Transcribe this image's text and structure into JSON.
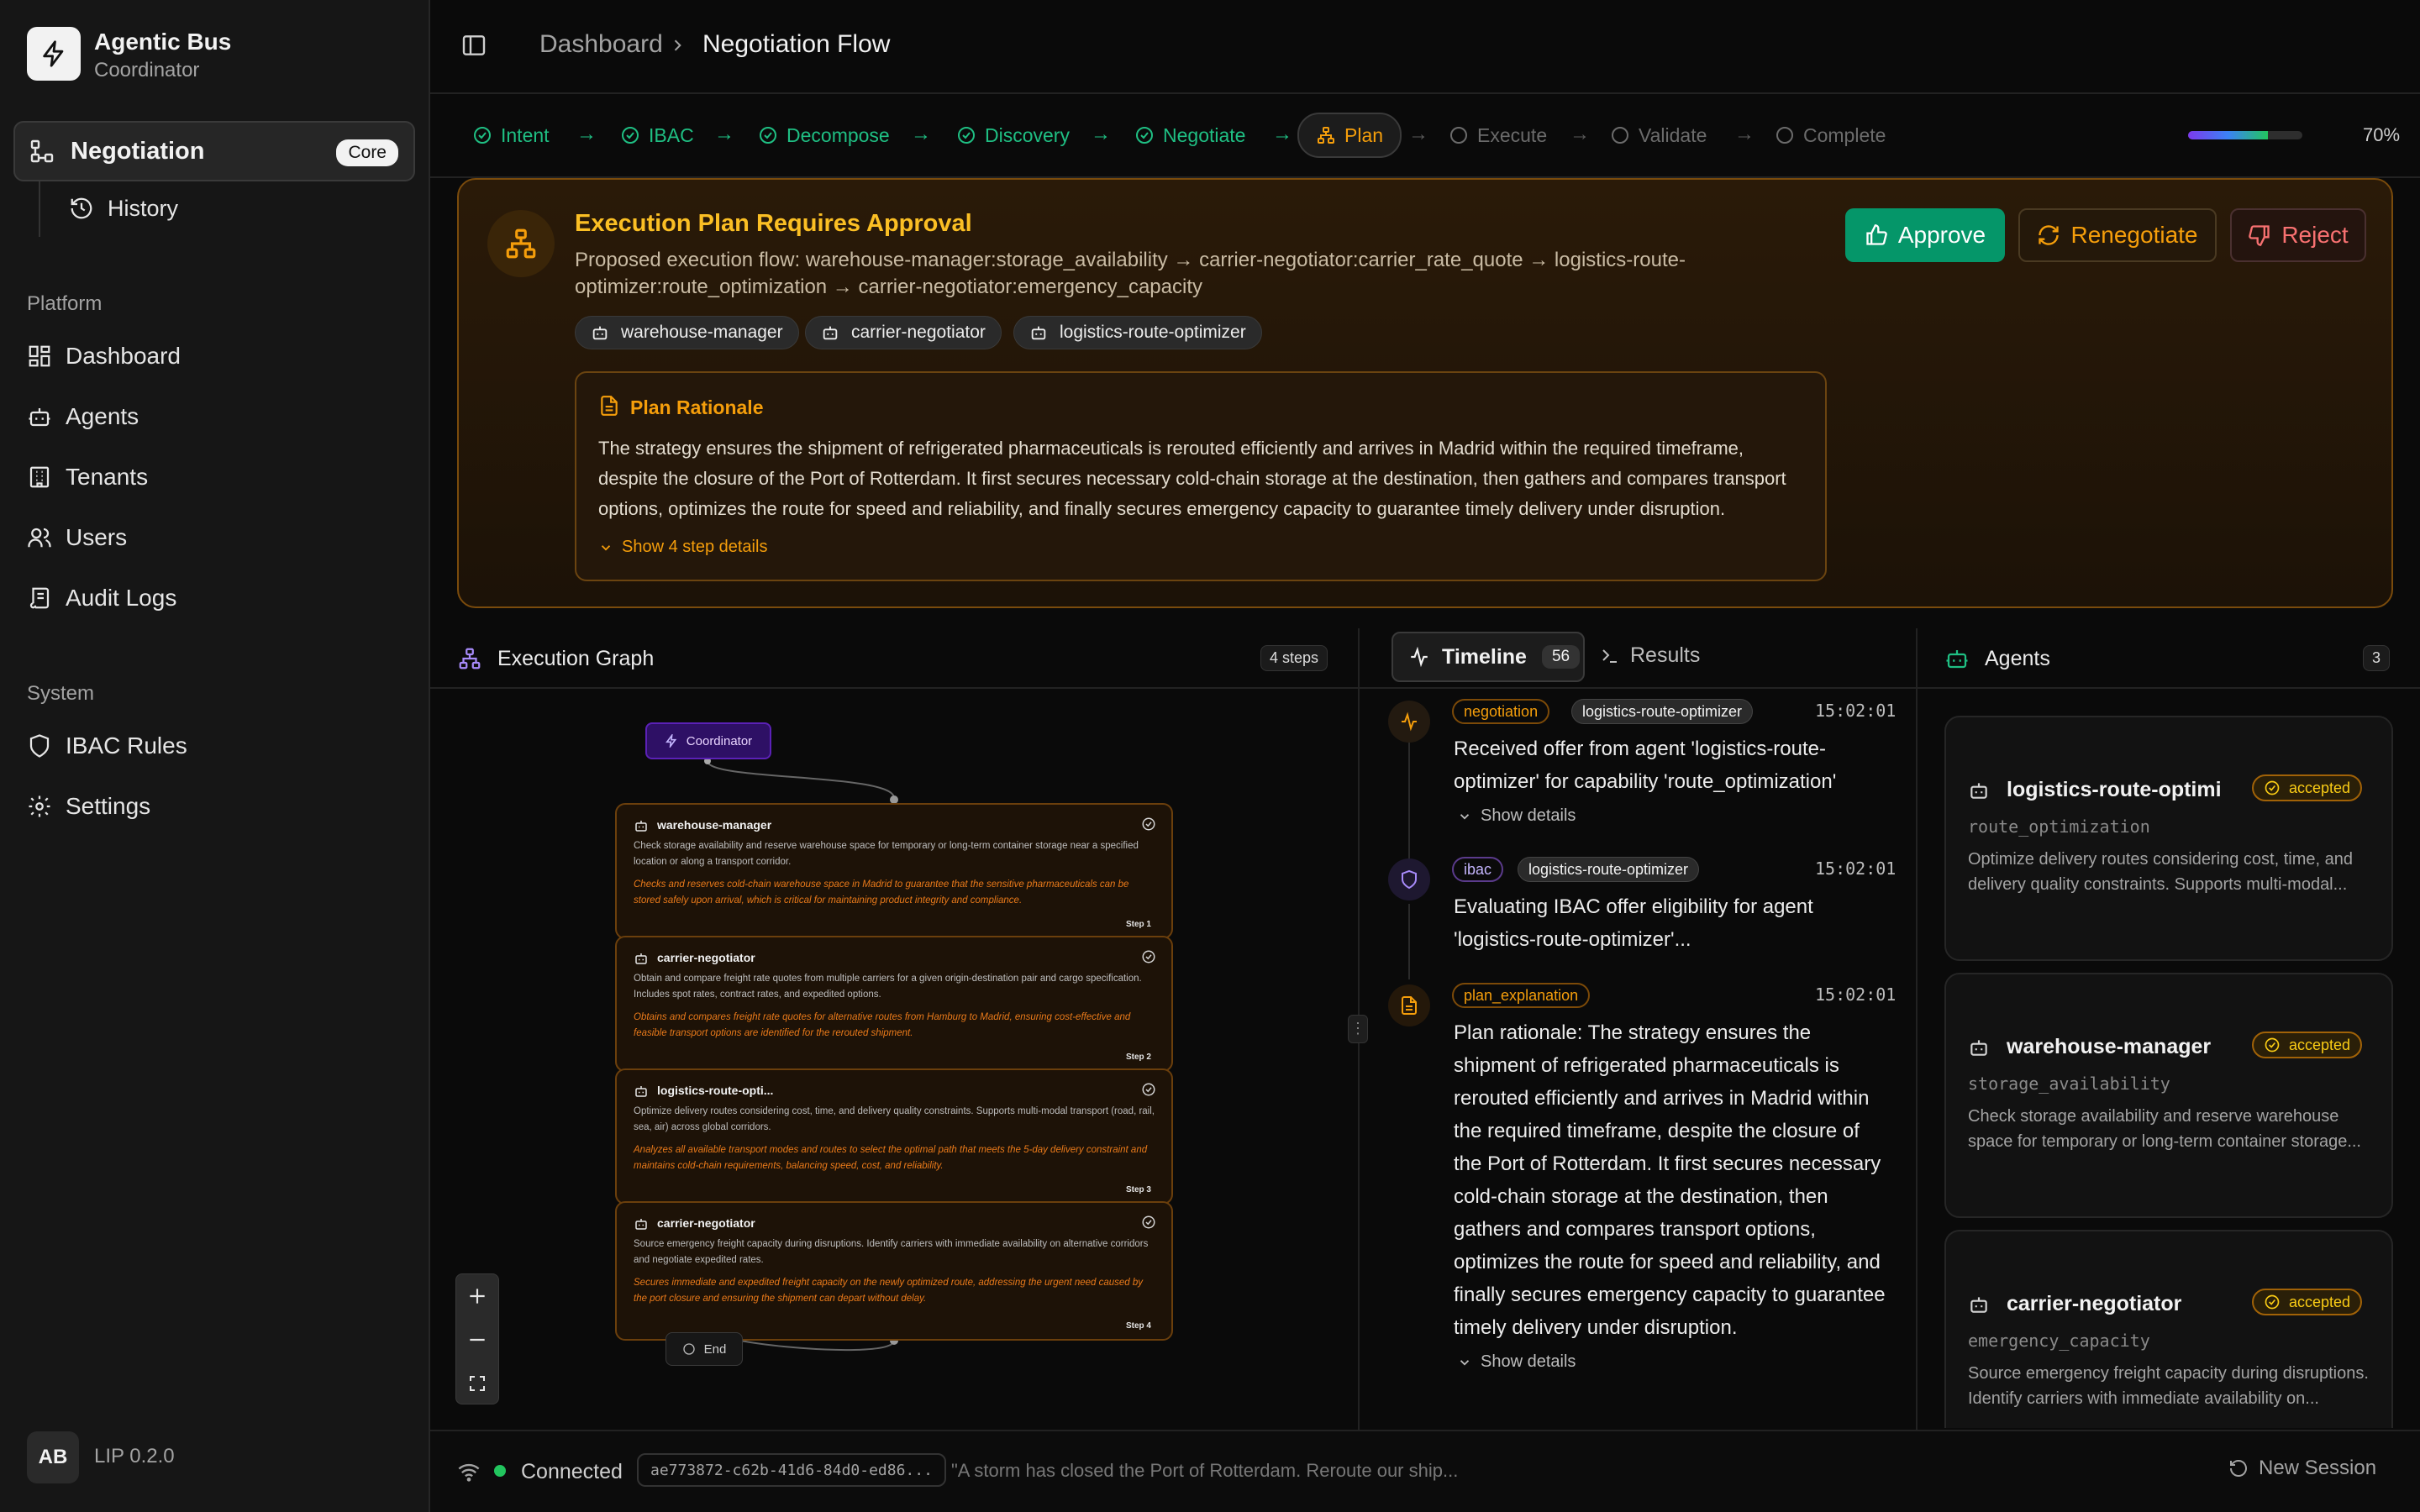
{
  "app": {
    "title": "Agentic Bus",
    "subtitle": "Coordinator"
  },
  "sidebar": {
    "active": {
      "label": "Negotiation",
      "badge": "Core"
    },
    "sub_item": "History",
    "platform_label": "Platform",
    "platform_items": [
      "Dashboard",
      "Agents",
      "Tenants",
      "Users",
      "Audit Logs"
    ],
    "system_label": "System",
    "system_items": [
      "IBAC Rules",
      "Settings"
    ],
    "user_initials": "AB",
    "version": "LIP 0.2.0"
  },
  "header": {
    "breadcrumb_root": "Dashboard",
    "breadcrumb_current": "Negotiation Flow"
  },
  "stepper": {
    "steps": [
      {
        "label": "Intent",
        "state": "done"
      },
      {
        "label": "IBAC",
        "state": "done"
      },
      {
        "label": "Decompose",
        "state": "done"
      },
      {
        "label": "Discovery",
        "state": "done"
      },
      {
        "label": "Negotiate",
        "state": "done"
      },
      {
        "label": "Plan",
        "state": "current"
      },
      {
        "label": "Execute",
        "state": "todo"
      },
      {
        "label": "Validate",
        "state": "todo"
      },
      {
        "label": "Complete",
        "state": "todo"
      }
    ],
    "progress": 0.7,
    "progress_label": "70%"
  },
  "approval": {
    "title": "Execution Plan Requires Approval",
    "flow": "Proposed execution flow: warehouse-manager:storage_availability → carrier-negotiator:carrier_rate_quote → logistics-route-optimizer:route_optimization → carrier-negotiator:emergency_capacity",
    "chips": [
      "warehouse-manager",
      "carrier-negotiator",
      "logistics-route-optimizer"
    ],
    "buttons": {
      "approve": "Approve",
      "renegotiate": "Renegotiate",
      "reject": "Reject"
    },
    "rationale_title": "Plan Rationale",
    "rationale_text": "The strategy ensures the shipment of refrigerated pharmaceuticals is rerouted efficiently and arrives in Madrid within the required timeframe, despite the closure of the Port of Rotterdam. It first secures necessary cold-chain storage at the destination, then gathers and compares transport options, optimizes the route for speed and reliability, and finally secures emergency capacity to guarantee timely delivery under disruption.",
    "rationale_more": "Show 4 step details"
  },
  "graph": {
    "title": "Execution Graph",
    "count": "4 steps",
    "coordinator": "Coordinator",
    "end": "End",
    "nodes": [
      {
        "name": "warehouse-manager",
        "desc": "Check storage availability and reserve warehouse space for temporary or long-term container storage near a specified location or along a transport corridor.",
        "reason": "Checks and reserves cold-chain warehouse space in Madrid to guarantee that the sensitive pharmaceuticals can be stored safely upon arrival, which is critical for maintaining product integrity and compliance.",
        "step": "Step 1"
      },
      {
        "name": "carrier-negotiator",
        "desc": "Obtain and compare freight rate quotes from multiple carriers for a given origin-destination pair and cargo specification. Includes spot rates, contract rates, and expedited options.",
        "reason": "Obtains and compares freight rate quotes for alternative routes from Hamburg to Madrid, ensuring cost-effective and feasible transport options are identified for the rerouted shipment.",
        "step": "Step 2"
      },
      {
        "name": "logistics-route-opti...",
        "desc": "Optimize delivery routes considering cost, time, and delivery quality constraints. Supports multi-modal transport (road, rail, sea, air) across global corridors.",
        "reason": "Analyzes all available transport modes and routes to select the optimal path that meets the 5-day delivery constraint and maintains cold-chain requirements, balancing speed, cost, and reliability.",
        "step": "Step 3"
      },
      {
        "name": "carrier-negotiator",
        "desc": "Source emergency freight capacity during disruptions. Identify carriers with immediate availability on alternative corridors and negotiate expedited rates.",
        "reason": "Secures immediate and expedited freight capacity on the newly optimized route, addressing the urgent need caused by the port closure and ensuring the shipment can depart without delay.",
        "step": "Step 4"
      }
    ]
  },
  "timeline": {
    "tab_label": "Timeline",
    "tab_count": "56",
    "results_label": "Results",
    "events": [
      {
        "type": "negotiation",
        "agent": "logistics-route-optimizer",
        "time": "15:02:01",
        "text": "Received offer from agent 'logistics-route-optimizer' for capability 'route_optimization'",
        "more": "Show details"
      },
      {
        "type": "ibac",
        "agent": "logistics-route-optimizer",
        "time": "15:02:01",
        "text": "Evaluating IBAC offer eligibility for agent 'logistics-route-optimizer'..."
      },
      {
        "type": "plan_explanation",
        "time": "15:02:01",
        "text": "Plan rationale: The strategy ensures the shipment of refrigerated pharmaceuticals is rerouted efficiently and arrives in Madrid within the required timeframe, despite the closure of the Port of Rotterdam. It first secures necessary cold-chain storage at the destination, then gathers and compares transport options, optimizes the route for speed and reliability, and finally secures emergency capacity to guarantee timely delivery under disruption.",
        "more": "Show details"
      }
    ]
  },
  "agents": {
    "title": "Agents",
    "count": "3",
    "items": [
      {
        "name": "logistics-route-optimi...",
        "status": "accepted",
        "capability": "route_optimization",
        "desc": "Optimize delivery routes considering cost, time, and delivery quality constraints. Supports multi-modal..."
      },
      {
        "name": "warehouse-manager",
        "status": "accepted",
        "capability": "storage_availability",
        "desc": "Check storage availability and reserve warehouse space for temporary or long-term container storage..."
      },
      {
        "name": "carrier-negotiator",
        "status": "accepted",
        "capability": "emergency_capacity",
        "desc": "Source emergency freight capacity during disruptions. Identify carriers with immediate availability on..."
      }
    ]
  },
  "footer": {
    "status": "Connected",
    "session_id": "ae773872-c62b-41d6-84d0-ed86...",
    "prompt": "\"A storm has closed the Port of Rotterdam. Reroute our ship...",
    "new_session": "New Session"
  },
  "colors": {
    "accent_green": "#1fbf83",
    "accent_amber": "#f59e0b",
    "accent_purple": "#7c3aed",
    "reject_red": "#f87171"
  }
}
